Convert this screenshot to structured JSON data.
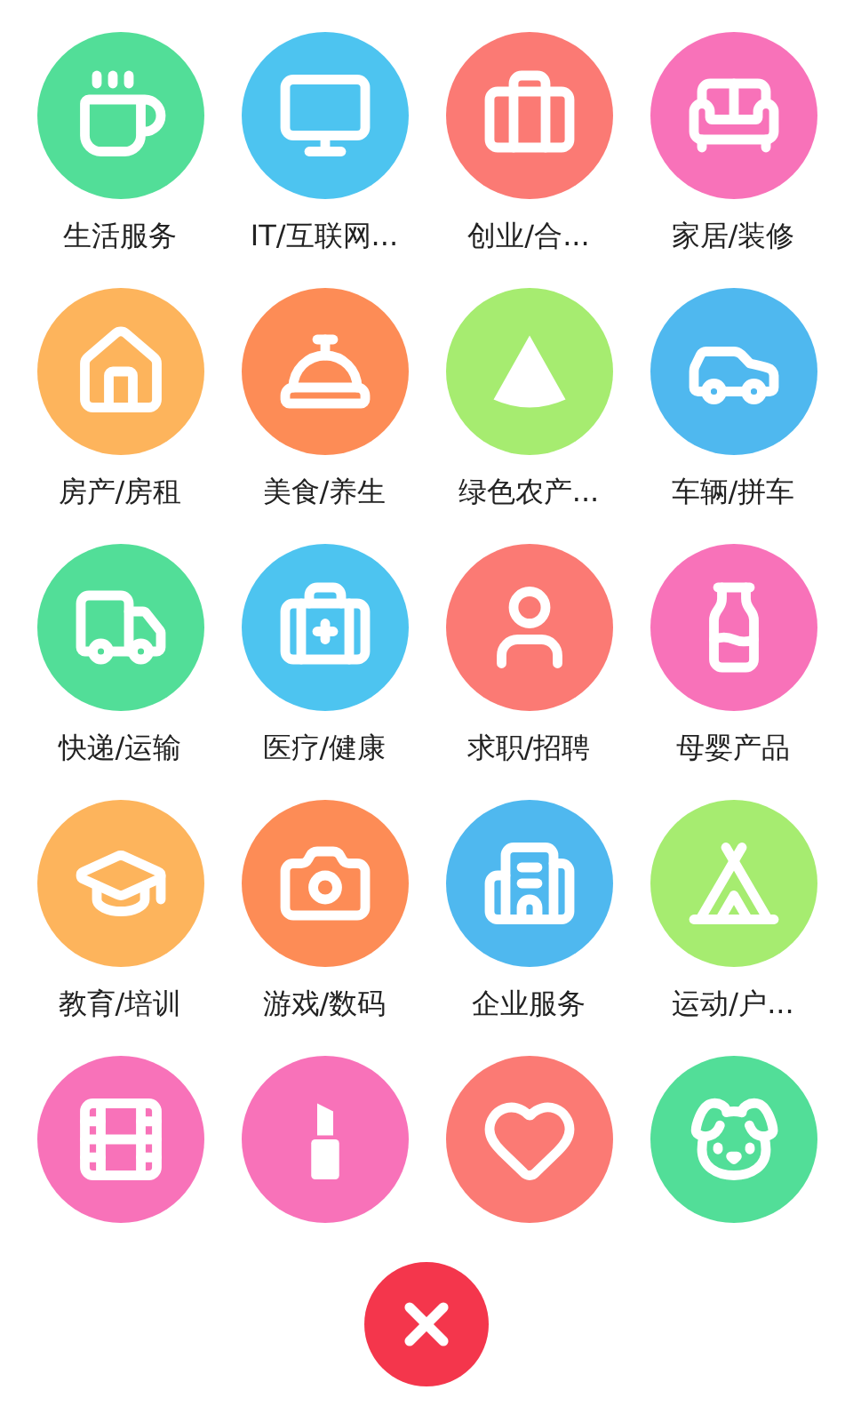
{
  "categories": [
    {
      "label": "生活服务",
      "color": "#52de98"
    },
    {
      "label": "IT/互联网...",
      "color": "#4dc4f0"
    },
    {
      "label": "创业/合...",
      "color": "#fb7a74"
    },
    {
      "label": "家居/装修",
      "color": "#f872b9"
    },
    {
      "label": "房产/房租",
      "color": "#fdb45c"
    },
    {
      "label": "美食/养生",
      "color": "#fd8c56"
    },
    {
      "label": "绿色农产...",
      "color": "#a6ec70"
    },
    {
      "label": "车辆/拼车",
      "color": "#4fb8ef"
    },
    {
      "label": "快递/运输",
      "color": "#52de98"
    },
    {
      "label": "医疗/健康",
      "color": "#4dc4f0"
    },
    {
      "label": "求职/招聘",
      "color": "#fb7a74"
    },
    {
      "label": "母婴产品",
      "color": "#f872b9"
    },
    {
      "label": "教育/培训",
      "color": "#fdb45c"
    },
    {
      "label": "游戏/数码",
      "color": "#fd8c56"
    },
    {
      "label": "企业服务",
      "color": "#4fb8ef"
    },
    {
      "label": "运动/户...",
      "color": "#a6ec70"
    },
    {
      "color": "#f872b9"
    },
    {
      "color": "#f872b9"
    },
    {
      "color": "#fb7a74"
    },
    {
      "color": "#52de98"
    }
  ]
}
